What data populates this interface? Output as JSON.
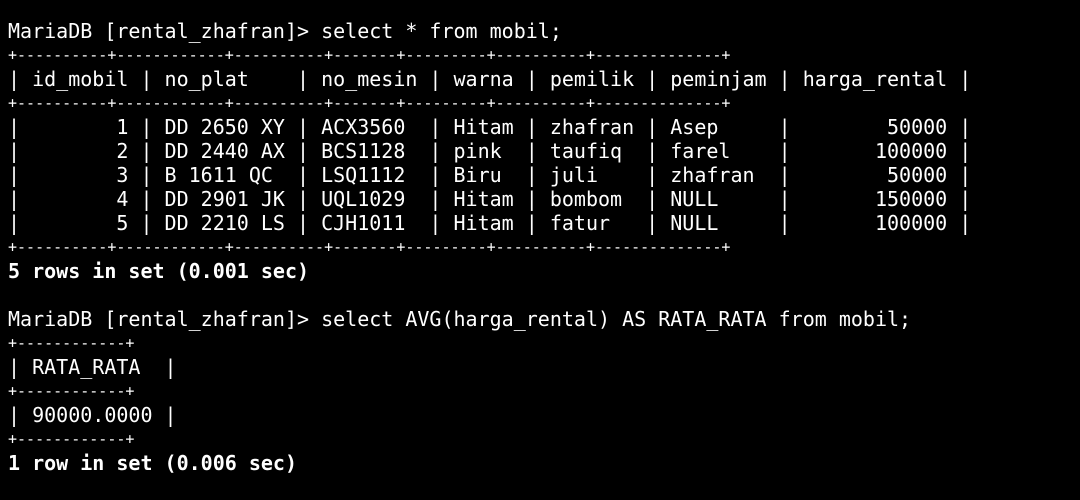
{
  "terminal": {
    "lines": [
      {
        "text": "MariaDB [rental_zhafran]> select * from mobil;",
        "kind": "prompt"
      },
      {
        "text": "+----------+------------+----------+-------+---------+----------+--------------+",
        "kind": "border"
      },
      {
        "text": "| id_mobil | no_plat    | no_mesin | warna | pemilik | peminjam | harga_rental |",
        "kind": "header"
      },
      {
        "text": "+----------+------------+----------+-------+---------+----------+--------------+",
        "kind": "border"
      },
      {
        "text": "|        1 | DD 2650 XY | ACX3560  | Hitam | zhafran | Asep     |        50000 |",
        "kind": "row"
      },
      {
        "text": "|        2 | DD 2440 AX | BCS1128  | pink  | taufiq  | farel    |       100000 |",
        "kind": "row"
      },
      {
        "text": "|        3 | B 1611 QC  | LSQ1112  | Biru  | juli    | zhafran  |        50000 |",
        "kind": "row"
      },
      {
        "text": "|        4 | DD 2901 JK | UQL1029  | Hitam | bombom  | NULL     |       150000 |",
        "kind": "row"
      },
      {
        "text": "|        5 | DD 2210 LS | CJH1011  | Hitam | fatur   | NULL     |       100000 |",
        "kind": "row"
      },
      {
        "text": "+----------+------------+----------+-------+---------+----------+--------------+",
        "kind": "border"
      },
      {
        "text": "5 rows in set (0.001 sec)",
        "kind": "status"
      },
      {
        "text": "",
        "kind": "blank"
      },
      {
        "text": "MariaDB [rental_zhafran]> select AVG(harga_rental) AS RATA_RATA from mobil;",
        "kind": "prompt"
      },
      {
        "text": "+------------+",
        "kind": "border"
      },
      {
        "text": "| RATA_RATA  |",
        "kind": "header"
      },
      {
        "text": "+------------+",
        "kind": "border"
      },
      {
        "text": "| 90000.0000 |",
        "kind": "row"
      },
      {
        "text": "+------------+",
        "kind": "border"
      },
      {
        "text": "1 row in set (0.006 sec)",
        "kind": "status"
      }
    ]
  },
  "colors": {
    "background": "#000000",
    "foreground": "#ffffff"
  }
}
